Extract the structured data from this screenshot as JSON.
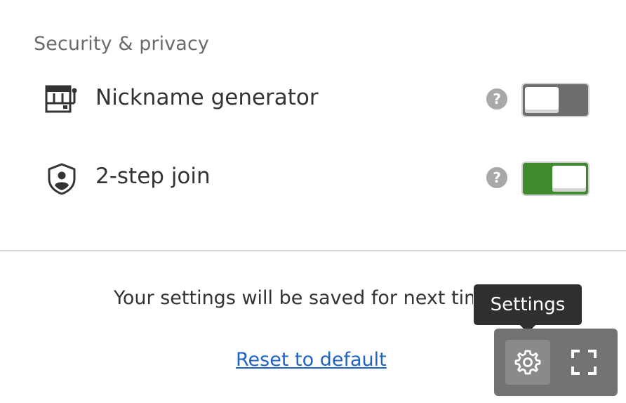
{
  "section": {
    "title": "Security & privacy"
  },
  "settings": [
    {
      "label": "Nickname generator",
      "icon": "slot-machine-icon",
      "help_icon": "help-icon",
      "toggle": {
        "state": "off"
      }
    },
    {
      "label": "2-step join",
      "icon": "shield-user-icon",
      "help_icon": "help-icon",
      "toggle": {
        "state": "on"
      }
    }
  ],
  "footer": {
    "note": "Your settings will be saved for next time.",
    "reset_link": "Reset to default"
  },
  "tooltip": {
    "text": "Settings"
  },
  "toolbar": {
    "settings_icon": "gear-icon",
    "fullscreen_icon": "fullscreen-icon"
  },
  "colors": {
    "toggle_on": "#3f8a2f",
    "toggle_off": "#6e6e6e",
    "link": "#1f64c4",
    "toolbar_bg": "#727272",
    "tooltip_bg": "#2f2f2f"
  }
}
